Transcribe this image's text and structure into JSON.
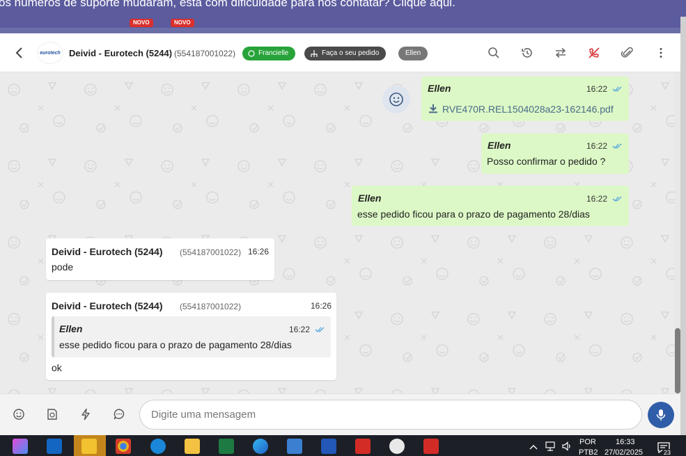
{
  "banner": {
    "text": "os números de suporte mudaram, está com dificuldade para nos contatar? Clique aqui.",
    "badge_1": "NOVO",
    "badge_2": "NOVO"
  },
  "header": {
    "logo_text": "eurotech",
    "contact_name": "Deivid - Eurotech (5244)",
    "contact_phone": "(554187001022)",
    "tag_whatsapp": "Francielle",
    "tag_order": "Faça o seu pedido",
    "tag_user": "Ellen"
  },
  "messages": {
    "m1": {
      "sender": "Ellen",
      "time": "16:22",
      "file": "RVE470R.REL1504028a23-162146.pdf"
    },
    "m2": {
      "sender": "Ellen",
      "time": "16:22",
      "text": "Posso confirmar o pedido ?"
    },
    "m3": {
      "sender": "Ellen",
      "time": "16:22",
      "text": "esse pedido ficou para o prazo de pagamento 28/dias"
    },
    "m4": {
      "sender": "Deivid - Eurotech (5244)",
      "phone": "(554187001022)",
      "time": "16:26",
      "text": "pode"
    },
    "m5": {
      "sender": "Deivid - Eurotech (5244)",
      "phone": "(554187001022)",
      "time": "16:26",
      "quote_sender": "Ellen",
      "quote_time": "16:22",
      "quote_text": "esse pedido ficou para o prazo de pagamento 28/dias",
      "text": "ok"
    }
  },
  "composer": {
    "placeholder": "Digite uma mensagem"
  },
  "taskbar": {
    "lang_1": "POR",
    "lang_2": "PTB2",
    "time": "16:33",
    "date": "27/02/2025",
    "notifications": "23"
  },
  "colors": {
    "outgoing_bubble": "#dcf8c6",
    "incoming_bubble": "#ffffff",
    "banner": "#5b5b9e",
    "whatsapp_tag": "#27a339",
    "mic_button": "#2f5da8"
  }
}
